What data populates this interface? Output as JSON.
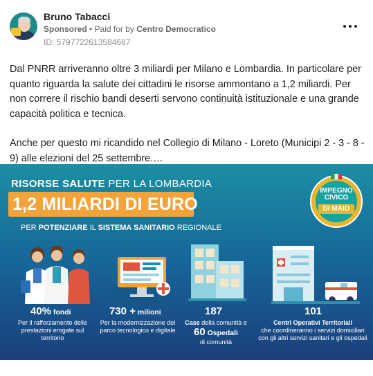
{
  "header": {
    "page_name": "Bruno Tabacci",
    "sponsored_label": "Sponsored",
    "paid_for_prefix": "• Paid for by",
    "paid_for_name": "Centro Democratico",
    "ad_id": "ID: 5797722613584687"
  },
  "post": {
    "paragraph_1": "Dal PNRR arriveranno oltre 3 miliardi per Milano e Lombardia. In particolare per quanto riguarda la salute dei cittadini le risorse ammontano a 1,2 miliardi. Per non correre il rischio bandi deserti servono continuità istituzionale e una grande capacità politica e tecnica.",
    "paragraph_2": "Anche per questo mi ricandido nel Collegio di Milano - Loreto (Municipi 2 - 3 - 8 - 9) alle elezioni del 25 settembre.…"
  },
  "banner": {
    "title_bold": "RISORSE SALUTE",
    "title_rest": " PER LA LOMBARDIA",
    "amount": "1,2 MILIARDI DI EURO",
    "subtitle_pre": "PER ",
    "subtitle_bold": "POTENZIARE",
    "subtitle_mid": " IL ",
    "subtitle_bold2": "SISTEMA SANITARIO",
    "subtitle_post": " REGIONALE",
    "logo": {
      "line1": "IMPEGNO",
      "line2": "CIVICO",
      "line3": "DI MAIO"
    },
    "stats": [
      {
        "num": "40%",
        "unit": " fondi",
        "text": "Per il rafforzamento delle prestazioni erogate sul territorio"
      },
      {
        "num": "730 +",
        "unit": " milioni",
        "text": "Per la modernizzazione del parco tecnologico e digitale"
      },
      {
        "num": "187",
        "text_bold": "Case",
        "text": " della comunità e",
        "num2": "60",
        "unit2": " Ospedali",
        "text2": "di comunità"
      },
      {
        "num": "101",
        "text_bold": "Centri Operativi Territoriali",
        "text": "che coordineranno i servizi domiciliari con gli altri servizi sanitari e gli ospedali"
      }
    ],
    "colors": {
      "accent_orange": "#f2a33a",
      "bg_top": "#1b8fa3",
      "bg_bottom": "#1a3f7d"
    }
  }
}
